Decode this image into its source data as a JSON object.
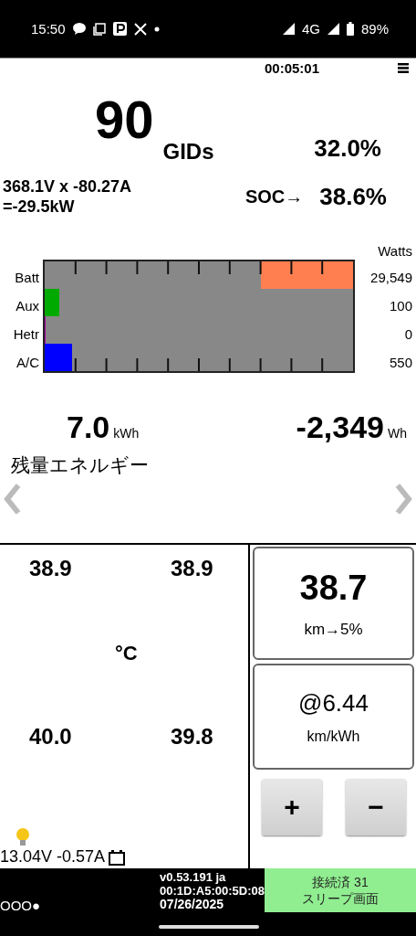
{
  "status_bar": {
    "time": "15:50",
    "network": "4G",
    "battery": "89%"
  },
  "header": {
    "timer": "00:05:01"
  },
  "gids": {
    "value": "90",
    "unit": "GIDs",
    "percent": "32.0%"
  },
  "pack": {
    "line_1": "368.1V x -80.27A",
    "line_2": "=-29.5kW",
    "soc_label": "SOC→",
    "soc": "38.6%"
  },
  "power": {
    "unit_label": "Watts",
    "rows": [
      {
        "label": "Batt",
        "value": "29,549",
        "level": 0.3,
        "color": "#ff7f50",
        "kind": "reverse"
      },
      {
        "label": "Aux",
        "value": "100",
        "level": 0.047,
        "color": "#00aa00",
        "kind": "normal"
      },
      {
        "label": "Hetr",
        "value": "0",
        "level": 0,
        "color": "#aa00aa",
        "kind": "normal"
      },
      {
        "label": "A/C",
        "value": "550",
        "level": 0.088,
        "color": "#0000ff",
        "kind": "normal"
      }
    ]
  },
  "energy": {
    "remaining": "7.0",
    "remaining_unit": "kWh",
    "delta": "-2,349",
    "delta_unit": "Wh",
    "caption": "残量エネルギー"
  },
  "temps": {
    "values": [
      "38.9",
      "38.9",
      "40.0",
      "39.8"
    ],
    "unit": "°C"
  },
  "aux_battery": {
    "reading": "13.04V -0.57A"
  },
  "range": {
    "value": "38.7",
    "caption": "km→5%"
  },
  "efficiency": {
    "value": "@6.44",
    "unit": "km/kWh"
  },
  "buttons": [
    "+",
    "−"
  ],
  "bottom": {
    "dots": "OOO●",
    "version": "v0.53.191 ja",
    "address": "00:1D:A5:00:5D:08",
    "date": "07/26/2025",
    "connection": "接続済 31",
    "sleep": "スリープ画面"
  }
}
